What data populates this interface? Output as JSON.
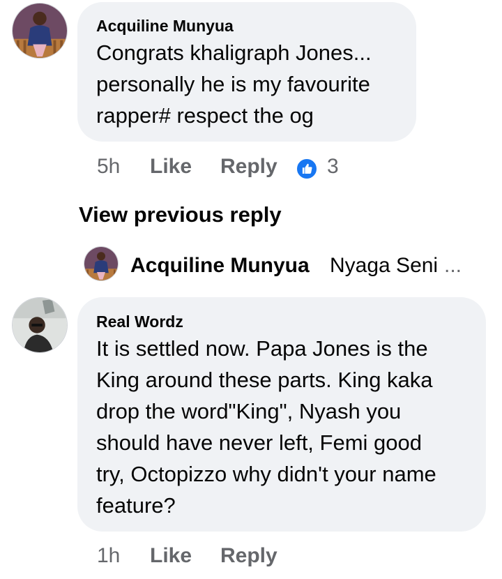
{
  "comments": [
    {
      "author": "Acquiline Munyua",
      "text_lines": [
        "Congrats khaligraph Jones...",
        "personally he is my favourite",
        "rapper# respect the og"
      ],
      "time": "5h",
      "like_label": "Like",
      "reply_label": "Reply",
      "reaction_icon": "thumbs-up-icon",
      "reaction_count": "3"
    },
    {
      "author": "Real Wordz",
      "text_lines": [
        "It is settled now. Papa Jones is the",
        "King around these parts. King kaka",
        "drop the word\"King\", Nyash you",
        "should have never left, Femi good",
        "try, Octopizzo why didn't your name",
        "feature?"
      ],
      "time": "1h",
      "like_label": "Like",
      "reply_label": "Reply"
    }
  ],
  "replies": {
    "view_previous_label": "View previous reply",
    "preview_author": "Acquiline Munyua",
    "preview_text": "Nyaga Seni",
    "preview_ellipsis": "..."
  },
  "colors": {
    "bubble": "#f0f2f5",
    "meta": "#65676b",
    "like_blue": "#1877f2"
  }
}
